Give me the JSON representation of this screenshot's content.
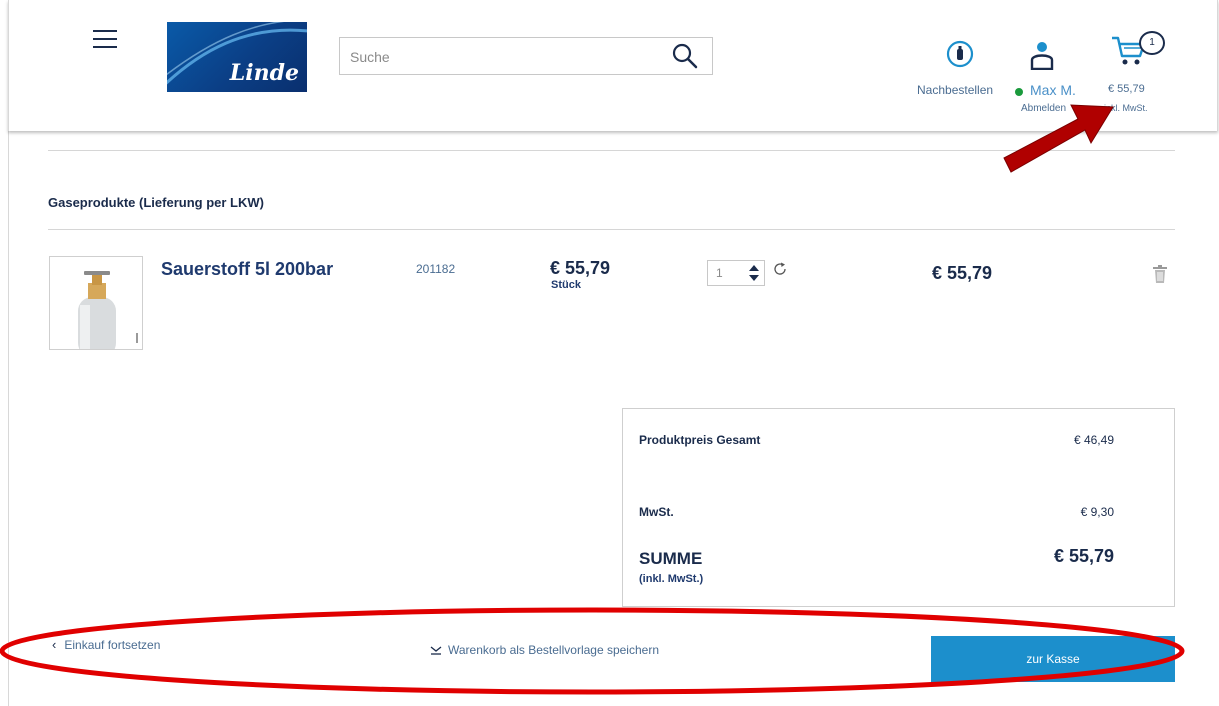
{
  "header": {
    "brand": "Linde",
    "search_placeholder": "Suche",
    "reorder_label": "Nachbestellen",
    "user_name": "Max M.",
    "logout_label": "Abmelden",
    "cart_count": "1",
    "cart_total": "€ 55,79",
    "cart_vat_note": "inkl. MwSt.",
    "icons": [
      "menu-icon",
      "search-icon",
      "reorder-icon",
      "user-icon",
      "cart-icon"
    ]
  },
  "cart": {
    "section_title": "Gaseprodukte (Lieferung per LKW)",
    "items": [
      {
        "name": "Sauerstoff 5l 200bar",
        "article_no": "201182",
        "unit_price": "€ 55,79",
        "unit_label": "Stück",
        "quantity": "1",
        "line_total": "€ 55,79"
      }
    ]
  },
  "summary": {
    "subtotal_label": "Produktpreis Gesamt",
    "subtotal_value": "€ 46,49",
    "vat_label": "MwSt.",
    "vat_value": "€ 9,30",
    "total_label": "SUMME",
    "total_sub": "(inkl. MwSt.)",
    "total_value": "€ 55,79"
  },
  "actions": {
    "continue_shopping": "Einkauf fortsetzen",
    "save_template": "Warenkorb als Bestellvorlage speichern",
    "checkout": "zur Kasse"
  },
  "colors": {
    "primary_blue": "#1c8fcc",
    "navy_text": "#1a2b4b",
    "annotation_red": "#e00000",
    "arrow_red": "#b00000",
    "online_green": "#1a9a3c"
  }
}
